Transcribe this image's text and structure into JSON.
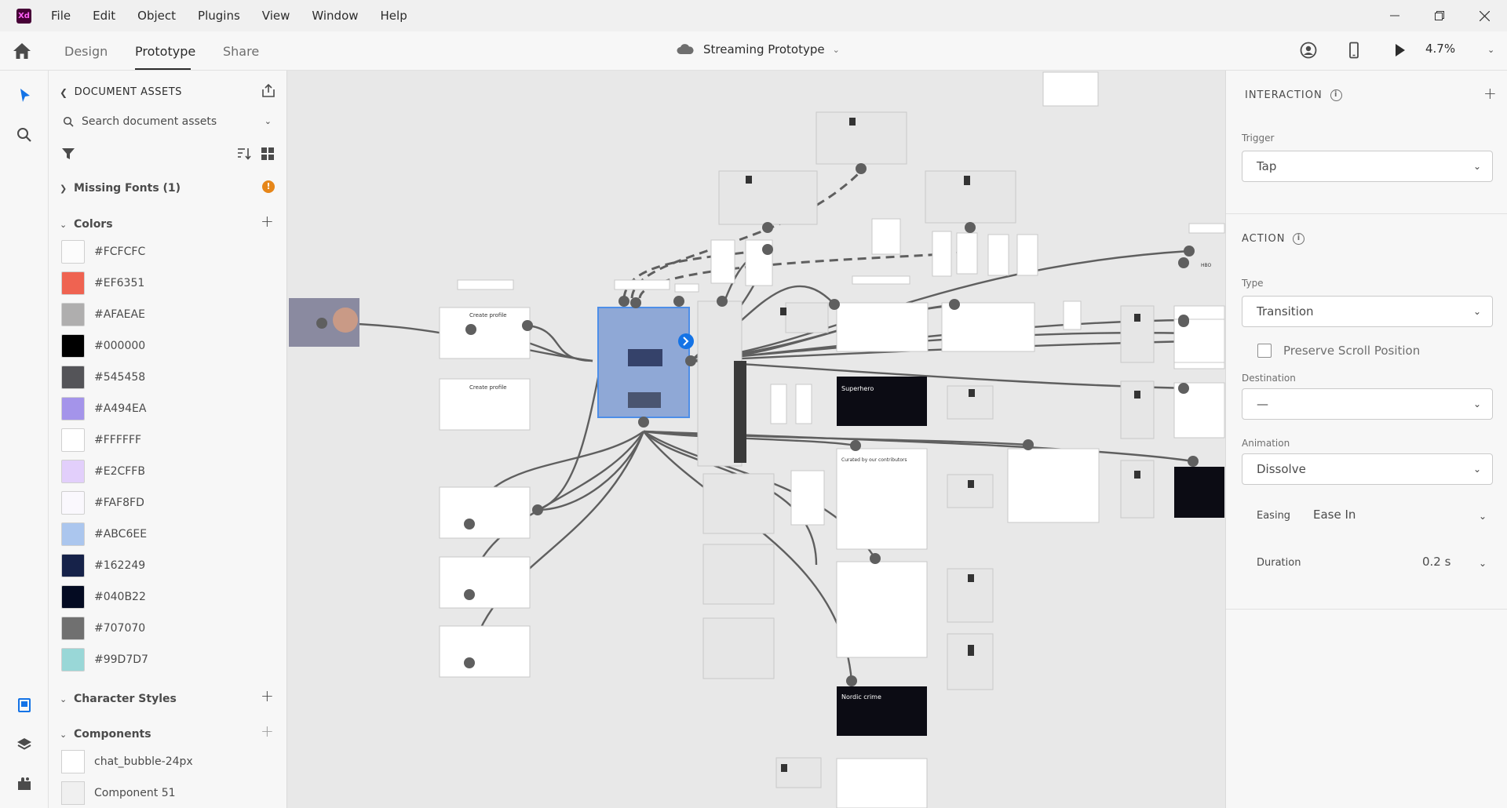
{
  "app": {
    "logo_text": "Xd"
  },
  "menu": [
    "File",
    "Edit",
    "Object",
    "Plugins",
    "View",
    "Window",
    "Help"
  ],
  "modes": {
    "design": "Design",
    "prototype": "Prototype",
    "share": "Share"
  },
  "document": {
    "title": "Streaming  Prototype"
  },
  "zoom": "4.7%",
  "assets": {
    "header": "DOCUMENT ASSETS",
    "search_placeholder": "Search document assets",
    "missing_fonts": "Missing Fonts (1)",
    "warning_mark": "!",
    "colors_title": "Colors",
    "colors": [
      "#FCFCFC",
      "#EF6351",
      "#AFAEAE",
      "#000000",
      "#545458",
      "#A494EA",
      "#FFFFFF",
      "#E2CFFB",
      "#FAF8FD",
      "#ABC6EE",
      "#162249",
      "#040B22",
      "#707070",
      "#99D7D7"
    ],
    "character_styles_title": "Character Styles",
    "components_title": "Components",
    "components": [
      "chat_bubble-24px",
      "Component 51"
    ]
  },
  "interaction": {
    "section_title": "INTERACTION",
    "trigger_label": "Trigger",
    "trigger_value": "Tap"
  },
  "action": {
    "section_title": "ACTION",
    "type_label": "Type",
    "type_value": "Transition",
    "preserve_scroll_label": "Preserve Scroll Position",
    "destination_label": "Destination",
    "destination_value": "—",
    "animation_label": "Animation",
    "animation_value": "Dissolve",
    "easing_label": "Easing",
    "easing_value": "Ease In",
    "duration_label": "Duration",
    "duration_value": "0.2 s"
  },
  "canvas_labels": {
    "create_profile_1": "Create profile",
    "create_profile_2": "Create profile",
    "superhero": "Superhero",
    "curated": "Curated by our contributors",
    "nordic": "Nordic crime",
    "hbo": "HBO"
  }
}
